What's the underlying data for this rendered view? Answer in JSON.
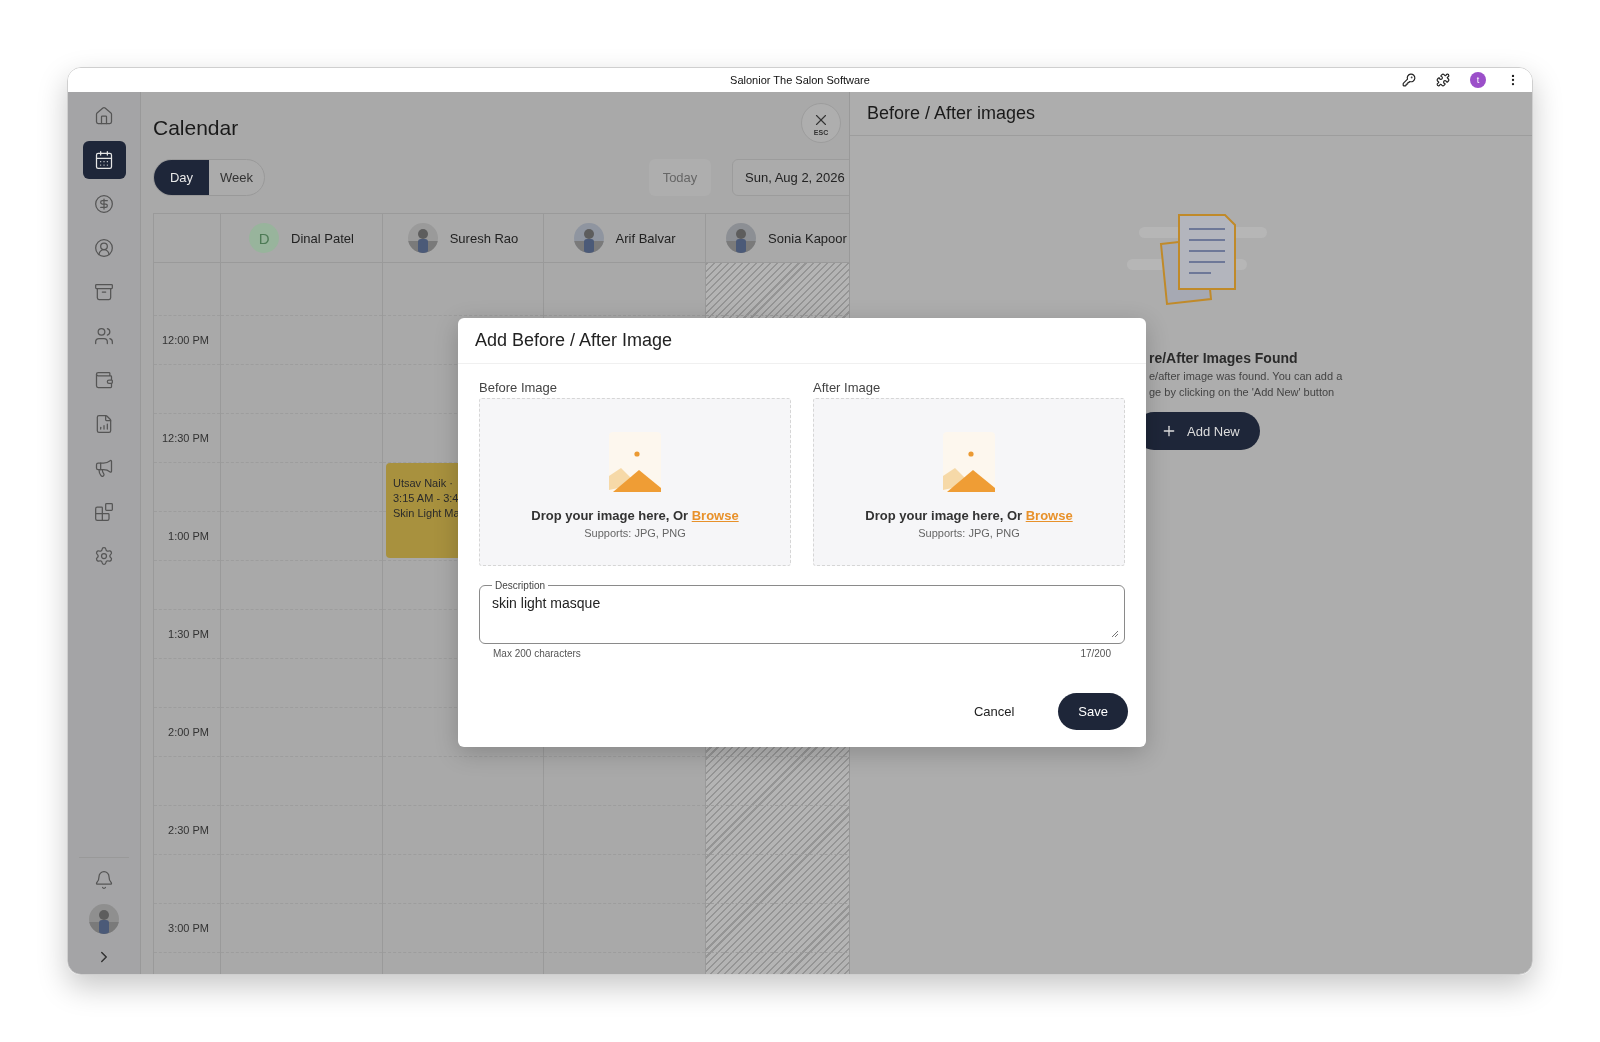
{
  "window": {
    "title": "Salonior The Salon Software",
    "profile_initial": "t"
  },
  "sidebar": {
    "items": [
      {
        "selected": false
      },
      {
        "selected": true
      },
      {
        "selected": false
      },
      {
        "selected": false
      },
      {
        "selected": false
      },
      {
        "selected": false
      },
      {
        "selected": false
      },
      {
        "selected": false
      },
      {
        "selected": false
      },
      {
        "selected": false
      },
      {
        "selected": false
      }
    ]
  },
  "calendar": {
    "title": "Calendar",
    "close_hint": "ESC",
    "views": [
      {
        "label": "Day",
        "selected": true
      },
      {
        "label": "Week",
        "selected": false
      }
    ],
    "today": "Today",
    "date": "Sun, Aug 2, 2026",
    "staff": [
      {
        "name": "Dinal Patel",
        "kind": "initial",
        "initial": "D",
        "unavailable": false
      },
      {
        "name": "Suresh Rao",
        "unavailable": false,
        "appointments": [
          {
            "lines": [
              "Utsav Naik ·",
              "3:15 AM - 3:4",
              "Skin Light Ma"
            ]
          }
        ]
      },
      {
        "name": "Arif Balvar",
        "unavailable": false
      },
      {
        "name": "Sonia Kapoor",
        "unavailable": true
      }
    ],
    "times": [
      "12:00 PM",
      "12:30 PM",
      "1:00 PM",
      "1:30 PM",
      "2:00 PM",
      "2:30 PM",
      "3:00 PM"
    ]
  },
  "panel": {
    "title": "Before / After images",
    "empty_title": "re/After Images Found",
    "empty_lines": [
      "e/after image was found. You can add a",
      "ge by clicking on the 'Add New' button"
    ],
    "add_button": "Add New"
  },
  "modal": {
    "title": "Add Before / After Image",
    "uploads": [
      {
        "label": "Before Image",
        "prompt": "Drop your image here, Or",
        "link": "Browse",
        "formats": "Supports: JPG, PNG"
      },
      {
        "label": "After Image",
        "prompt": "Drop your image here, Or",
        "link": "Browse",
        "formats": "Supports: JPG, PNG"
      }
    ],
    "description": {
      "label": "Description",
      "value": "skin light masque",
      "hint": "Max 200 characters",
      "counter": "17/200"
    },
    "buttons": [
      {
        "label": "Cancel",
        "kind": "text"
      },
      {
        "label": "Save",
        "kind": "primary"
      }
    ]
  }
}
